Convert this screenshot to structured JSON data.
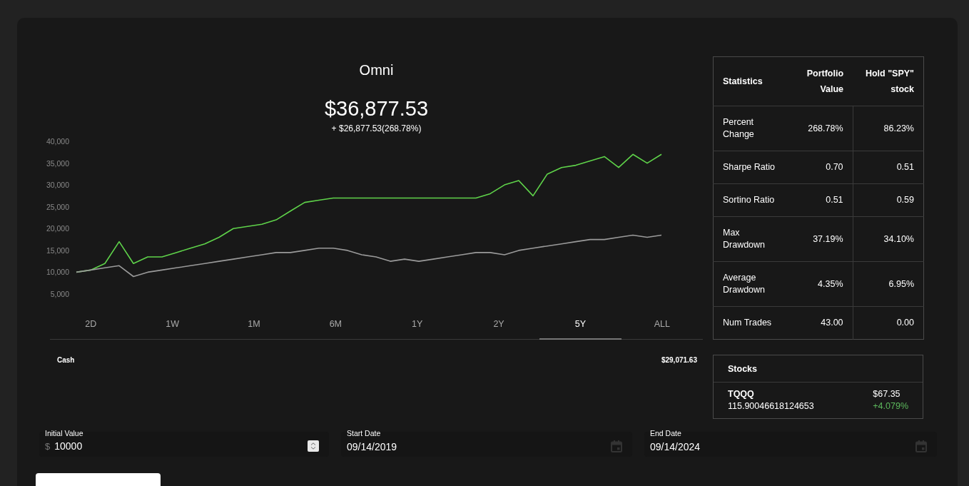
{
  "header": {
    "title": "Omni",
    "value": "$36,877.53",
    "change": "+ $26,877.53(268.78%)"
  },
  "chart_data": {
    "type": "line",
    "ylim": [
      5000,
      40000
    ],
    "yticks": [
      {
        "value": 5000,
        "label": "5,000"
      },
      {
        "value": 10000,
        "label": "10,000"
      },
      {
        "value": 15000,
        "label": "15,000"
      },
      {
        "value": 20000,
        "label": "20,000"
      },
      {
        "value": 25000,
        "label": "25,000"
      },
      {
        "value": 30000,
        "label": "30,000"
      },
      {
        "value": 35000,
        "label": "35,000"
      },
      {
        "value": 40000,
        "label": "40,000"
      }
    ],
    "series": [
      {
        "color": "#5fd34a",
        "values": [
          10000,
          10500,
          12000,
          17000,
          12000,
          13500,
          13500,
          14500,
          15500,
          16500,
          18000,
          20000,
          20500,
          21000,
          22000,
          24000,
          26000,
          26500,
          27000,
          27000,
          27000,
          27000,
          27000,
          27000,
          27000,
          27000,
          27000,
          27000,
          27000,
          28000,
          30000,
          31000,
          27500,
          32500,
          34000,
          34500,
          35500,
          36500,
          34000,
          37000,
          35000,
          37000
        ]
      },
      {
        "color": "#9a9a9a",
        "values": [
          10000,
          10500,
          11000,
          11500,
          9000,
          10000,
          10500,
          11000,
          11500,
          12000,
          12500,
          13000,
          13500,
          14000,
          14500,
          14500,
          15000,
          15500,
          15500,
          15000,
          14000,
          13500,
          12500,
          13000,
          12500,
          13000,
          13500,
          14000,
          14500,
          14500,
          14000,
          15000,
          15500,
          16000,
          16500,
          17000,
          17500,
          17500,
          18000,
          18500,
          18000,
          18500
        ]
      }
    ]
  },
  "range_tabs": [
    {
      "label": "2D",
      "selected": false
    },
    {
      "label": "1W",
      "selected": false
    },
    {
      "label": "1M",
      "selected": false
    },
    {
      "label": "6M",
      "selected": false
    },
    {
      "label": "1Y",
      "selected": false
    },
    {
      "label": "2Y",
      "selected": false
    },
    {
      "label": "5Y",
      "selected": true
    },
    {
      "label": "ALL",
      "selected": false
    }
  ],
  "cash": {
    "label": "Cash",
    "value": "$29,071.63"
  },
  "statistics": {
    "columns": [
      "Statistics",
      "Portfolio Value",
      "Hold \"SPY\" stock"
    ],
    "rows": [
      {
        "label": "Percent Change",
        "portfolio": "268.78%",
        "spy": "86.23%"
      },
      {
        "label": "Sharpe Ratio",
        "portfolio": "0.70",
        "spy": "0.51"
      },
      {
        "label": "Sortino Ratio",
        "portfolio": "0.51",
        "spy": "0.59"
      },
      {
        "label": "Max Drawdown",
        "portfolio": "37.19%",
        "spy": "34.10%"
      },
      {
        "label": "Average Drawdown",
        "portfolio": "4.35%",
        "spy": "6.95%"
      },
      {
        "label": "Num Trades",
        "portfolio": "43.00",
        "spy": "0.00"
      }
    ]
  },
  "stocks": {
    "title": "Stocks",
    "items": [
      {
        "symbol": "TQQQ",
        "shares": "115.90046618124653",
        "price": "$67.35",
        "change": "+4.079%",
        "positive": true
      }
    ]
  },
  "inputs": [
    {
      "kind": "number",
      "label": "Initial Value",
      "prefix": "$",
      "value": "10000"
    },
    {
      "kind": "date",
      "label": "Start Date",
      "value": "09/14/2019"
    },
    {
      "kind": "date",
      "label": "End Date",
      "value": "09/14/2024"
    }
  ]
}
